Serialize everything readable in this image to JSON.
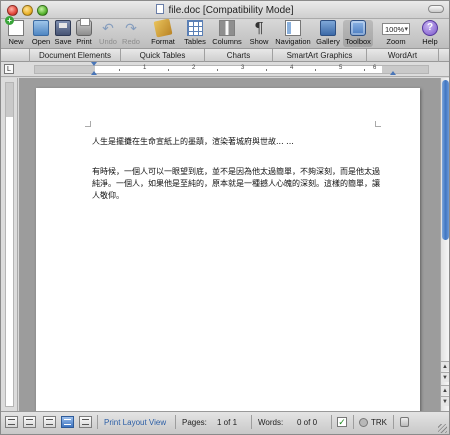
{
  "window": {
    "title": "file.doc [Compatibility Mode]"
  },
  "toolbar": {
    "new_label": "New",
    "open_label": "Open",
    "save_label": "Save",
    "print_label": "Print",
    "undo_label": "Undo",
    "redo_label": "Redo",
    "format_label": "Format",
    "tables_label": "Tables",
    "columns_label": "Columns",
    "show_label": "Show",
    "show_glyph": "¶",
    "navigation_label": "Navigation",
    "gallery_label": "Gallery",
    "toolbox_label": "Toolbox",
    "zoom_value": "100%",
    "zoom_label": "Zoom",
    "help_label": "Help",
    "help_glyph": "?"
  },
  "ribbon": {
    "tabs": [
      "Document Elements",
      "Quick Tables",
      "Charts",
      "SmartArt Graphics",
      "WordArt"
    ]
  },
  "ruler": {
    "numbers": [
      "1",
      "2",
      "3",
      "4",
      "5",
      "6"
    ]
  },
  "document": {
    "paragraph1": "人生是擺攤在生命宣紙上的墨蹟，渲染著城府與世故... ...",
    "paragraph2": "有時候，一個人可以一眼望到底，並不是因為他太過簡單，不夠深刻，而是他太過純淨。一個人，如果他是至純的，原本就是一種撼人心魄的深刻。這樣的簡單，讓人敬仰。"
  },
  "status": {
    "view_name": "Print Layout View",
    "pages_label": "Pages:",
    "pages_value": "1 of 1",
    "words_label": "Words:",
    "words_value": "0 of 0",
    "trk_label": "TRK"
  },
  "icons": {
    "new": "new-document-icon",
    "open": "open-folder-icon",
    "save": "save-disk-icon",
    "print": "printer-icon",
    "undo": "undo-arrow-icon",
    "redo": "redo-arrow-icon",
    "format": "format-brush-icon",
    "tables": "table-grid-icon",
    "columns": "columns-icon",
    "show": "pilcrow-icon",
    "navigation": "navigation-pane-icon",
    "gallery": "gallery-icon",
    "toolbox": "toolbox-icon",
    "help": "help-icon"
  },
  "colors": {
    "accent": "#3f76c2",
    "status_blue": "#2b5ea6",
    "canvas_gray": "#9c9c9c"
  }
}
